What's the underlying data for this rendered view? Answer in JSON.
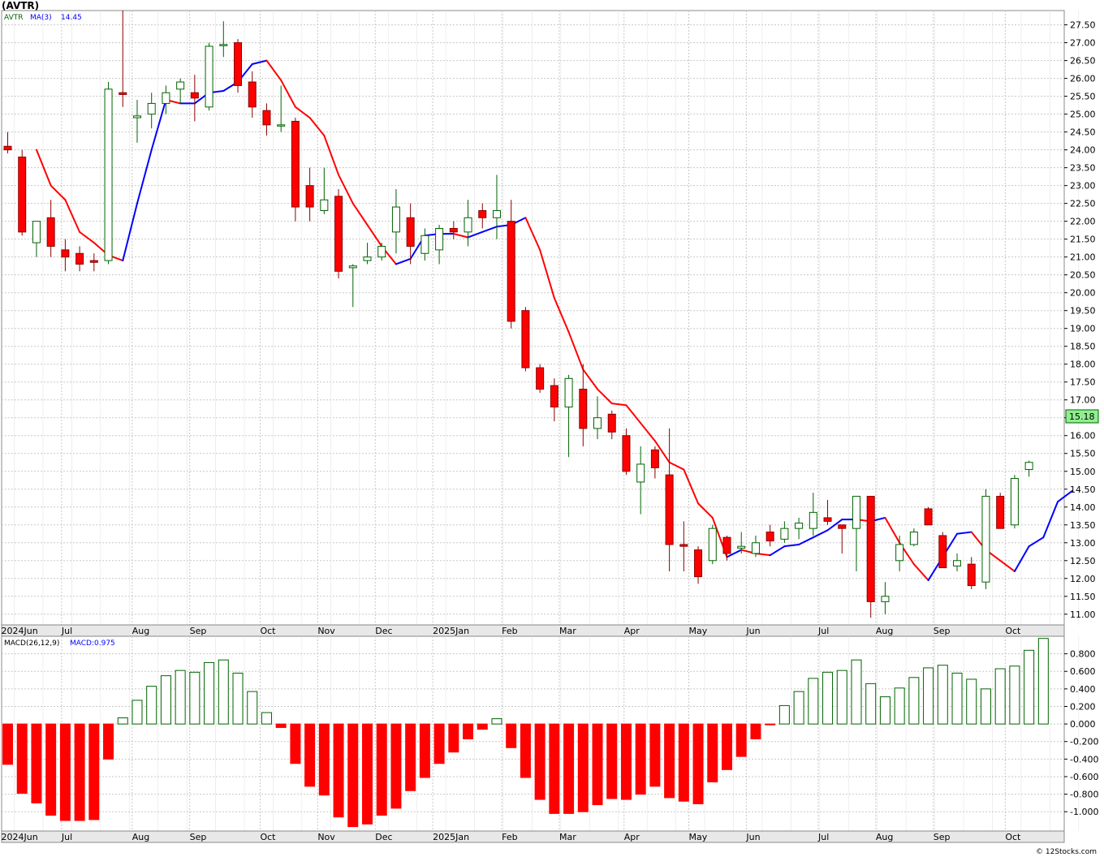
{
  "title": "(AVTR)",
  "watermark": "© 12Stocks.com",
  "colors": {
    "up_candle": "#ffffff",
    "up_outline": "#006400",
    "down_candle": "#ff0000",
    "ma_rising": "#0000ff",
    "ma_falling": "#ff0000",
    "last_price_box": "#90ee90",
    "grid": "#c8c8c8",
    "axis_band": "#e8e8e8"
  },
  "chart_data": [
    {
      "type": "candlestick",
      "symbol": "AVTR",
      "legend": {
        "symbol_label": "AVTR",
        "ma_label": "MA(3)",
        "ma_value": "14.45"
      },
      "last_price_label": "15.18",
      "ylim": [
        10.7,
        27.9
      ],
      "y_ticks": [
        "11.00",
        "11.50",
        "12.00",
        "12.50",
        "13.00",
        "13.50",
        "14.00",
        "14.50",
        "15.00",
        "15.50",
        "16.00",
        "16.50",
        "17.00",
        "17.50",
        "18.00",
        "18.50",
        "19.00",
        "19.50",
        "20.00",
        "20.50",
        "21.00",
        "21.50",
        "22.00",
        "22.50",
        "23.00",
        "23.50",
        "24.00",
        "24.50",
        "25.00",
        "25.50",
        "26.00",
        "26.50",
        "27.00",
        "27.50"
      ],
      "x_labels": [
        "2024Jun",
        "Jul",
        "Aug",
        "Sep",
        "Oct",
        "Nov",
        "Dec",
        "2025Jan",
        "Feb",
        "Mar",
        "Apr",
        "May",
        "Jun",
        "Jul",
        "Aug",
        "Sep",
        "Oct"
      ],
      "x_label_bars": [
        0,
        4.2,
        9.1,
        13.1,
        18.0,
        22.0,
        26.0,
        30.0,
        34.8,
        38.8,
        43.3,
        47.8,
        51.8,
        56.8,
        60.8,
        64.8,
        69.8
      ],
      "num_bars": 75,
      "candles": [
        {
          "o": 24.1,
          "h": 24.5,
          "l": 23.9,
          "c": 24.0
        },
        {
          "o": 23.8,
          "h": 24.0,
          "l": 21.6,
          "c": 21.7
        },
        {
          "o": 21.4,
          "h": 22.0,
          "l": 21.0,
          "c": 22.0
        },
        {
          "o": 22.1,
          "h": 22.6,
          "l": 21.0,
          "c": 21.3
        },
        {
          "o": 21.2,
          "h": 21.5,
          "l": 20.6,
          "c": 21.0
        },
        {
          "o": 21.1,
          "h": 21.3,
          "l": 20.6,
          "c": 20.8
        },
        {
          "o": 20.9,
          "h": 21.1,
          "l": 20.6,
          "c": 20.85
        },
        {
          "o": 20.9,
          "h": 25.9,
          "l": 20.8,
          "c": 25.7
        },
        {
          "o": 25.6,
          "h": 27.9,
          "l": 25.2,
          "c": 25.55
        },
        {
          "o": 24.9,
          "h": 25.4,
          "l": 24.2,
          "c": 24.95
        },
        {
          "o": 25.0,
          "h": 25.6,
          "l": 24.6,
          "c": 25.3
        },
        {
          "o": 25.3,
          "h": 25.8,
          "l": 25.0,
          "c": 25.6
        },
        {
          "o": 25.7,
          "h": 26.0,
          "l": 25.3,
          "c": 25.9
        },
        {
          "o": 25.6,
          "h": 26.1,
          "l": 24.8,
          "c": 25.45
        },
        {
          "o": 25.2,
          "h": 27.0,
          "l": 25.1,
          "c": 26.9
        },
        {
          "o": 26.95,
          "h": 27.6,
          "l": 26.6,
          "c": 26.95
        },
        {
          "o": 27.0,
          "h": 27.1,
          "l": 25.6,
          "c": 25.8
        },
        {
          "o": 25.9,
          "h": 26.2,
          "l": 24.9,
          "c": 25.2
        },
        {
          "o": 25.1,
          "h": 25.3,
          "l": 24.4,
          "c": 24.7
        },
        {
          "o": 24.7,
          "h": 25.8,
          "l": 24.5,
          "c": 24.7
        },
        {
          "o": 24.8,
          "h": 24.9,
          "l": 22.0,
          "c": 22.4
        },
        {
          "o": 23.0,
          "h": 23.5,
          "l": 22.0,
          "c": 22.4
        },
        {
          "o": 22.3,
          "h": 23.5,
          "l": 22.2,
          "c": 22.6
        },
        {
          "o": 22.7,
          "h": 22.9,
          "l": 20.4,
          "c": 20.6
        },
        {
          "o": 20.7,
          "h": 20.8,
          "l": 19.6,
          "c": 20.75
        },
        {
          "o": 20.9,
          "h": 21.4,
          "l": 20.8,
          "c": 21.0
        },
        {
          "o": 21.0,
          "h": 21.4,
          "l": 20.9,
          "c": 21.3
        },
        {
          "o": 21.7,
          "h": 22.9,
          "l": 21.1,
          "c": 22.4
        },
        {
          "o": 22.1,
          "h": 22.5,
          "l": 20.8,
          "c": 21.3
        },
        {
          "o": 21.1,
          "h": 21.8,
          "l": 20.9,
          "c": 21.6
        },
        {
          "o": 21.2,
          "h": 21.9,
          "l": 20.8,
          "c": 21.8
        },
        {
          "o": 21.8,
          "h": 22.0,
          "l": 21.5,
          "c": 21.7
        },
        {
          "o": 21.7,
          "h": 22.6,
          "l": 21.3,
          "c": 22.1
        },
        {
          "o": 22.3,
          "h": 22.5,
          "l": 21.8,
          "c": 22.1
        },
        {
          "o": 22.1,
          "h": 23.3,
          "l": 21.5,
          "c": 22.3
        },
        {
          "o": 22.0,
          "h": 22.6,
          "l": 19.0,
          "c": 19.2
        },
        {
          "o": 19.5,
          "h": 19.6,
          "l": 17.8,
          "c": 17.9
        },
        {
          "o": 17.9,
          "h": 18.0,
          "l": 17.2,
          "c": 17.3
        },
        {
          "o": 17.4,
          "h": 17.6,
          "l": 16.4,
          "c": 16.8
        },
        {
          "o": 16.8,
          "h": 17.7,
          "l": 15.4,
          "c": 17.6
        },
        {
          "o": 17.3,
          "h": 18.0,
          "l": 15.7,
          "c": 16.2
        },
        {
          "o": 16.2,
          "h": 17.1,
          "l": 15.9,
          "c": 16.5
        },
        {
          "o": 16.6,
          "h": 16.7,
          "l": 15.9,
          "c": 16.1
        },
        {
          "o": 16.0,
          "h": 16.2,
          "l": 14.9,
          "c": 15.0
        },
        {
          "o": 14.7,
          "h": 15.7,
          "l": 13.8,
          "c": 15.2
        },
        {
          "o": 15.6,
          "h": 15.7,
          "l": 14.8,
          "c": 15.1
        },
        {
          "o": 14.9,
          "h": 16.2,
          "l": 12.2,
          "c": 12.95
        },
        {
          "o": 12.95,
          "h": 13.6,
          "l": 12.2,
          "c": 12.9
        },
        {
          "o": 12.8,
          "h": 12.9,
          "l": 11.85,
          "c": 12.05
        },
        {
          "o": 12.5,
          "h": 13.5,
          "l": 12.4,
          "c": 13.4
        },
        {
          "o": 13.15,
          "h": 13.2,
          "l": 12.5,
          "c": 12.7
        },
        {
          "o": 12.85,
          "h": 13.3,
          "l": 12.7,
          "c": 12.9
        },
        {
          "o": 12.7,
          "h": 13.2,
          "l": 12.6,
          "c": 13.0
        },
        {
          "o": 13.3,
          "h": 13.5,
          "l": 12.9,
          "c": 13.05
        },
        {
          "o": 13.1,
          "h": 13.6,
          "l": 13.0,
          "c": 13.4
        },
        {
          "o": 13.4,
          "h": 13.7,
          "l": 13.1,
          "c": 13.55
        },
        {
          "o": 13.4,
          "h": 14.4,
          "l": 13.2,
          "c": 13.85
        },
        {
          "o": 13.7,
          "h": 14.2,
          "l": 13.5,
          "c": 13.6
        },
        {
          "o": 13.5,
          "h": 13.5,
          "l": 12.7,
          "c": 13.4
        },
        {
          "o": 13.4,
          "h": 14.3,
          "l": 12.2,
          "c": 14.3
        },
        {
          "o": 14.3,
          "h": 14.3,
          "l": 10.9,
          "c": 11.35
        },
        {
          "o": 11.35,
          "h": 11.9,
          "l": 11.0,
          "c": 11.5
        },
        {
          "o": 12.5,
          "h": 13.2,
          "l": 12.2,
          "c": 12.95
        },
        {
          "o": 12.95,
          "h": 13.4,
          "l": 12.9,
          "c": 13.3
        },
        {
          "o": 13.95,
          "h": 14.0,
          "l": 13.5,
          "c": 13.5
        },
        {
          "o": 13.2,
          "h": 13.3,
          "l": 12.3,
          "c": 12.3
        },
        {
          "o": 12.35,
          "h": 12.7,
          "l": 12.2,
          "c": 12.5
        },
        {
          "o": 12.4,
          "h": 12.6,
          "l": 11.7,
          "c": 11.8
        },
        {
          "o": 11.9,
          "h": 14.5,
          "l": 11.7,
          "c": 14.3
        },
        {
          "o": 14.3,
          "h": 14.4,
          "l": 13.4,
          "c": 13.4
        },
        {
          "o": 13.5,
          "h": 14.9,
          "l": 13.4,
          "c": 14.8
        },
        {
          "o": 15.05,
          "h": 15.3,
          "l": 14.85,
          "c": 15.25
        }
      ],
      "ma3": [
        24.0,
        23.0,
        22.6,
        21.7,
        21.4,
        21.05,
        20.9,
        22.5,
        24.0,
        25.4,
        25.3,
        25.3,
        25.6,
        25.65,
        25.9,
        26.4,
        26.5,
        25.95,
        25.2,
        24.9,
        24.4,
        23.3,
        22.5,
        21.9,
        21.3,
        20.8,
        20.95,
        21.6,
        21.65,
        21.65,
        21.55,
        21.7,
        21.85,
        21.9,
        22.1,
        21.2,
        19.85,
        18.9,
        17.85,
        17.3,
        16.9,
        16.85,
        16.35,
        15.85,
        15.25,
        15.05,
        14.1,
        13.7,
        12.6,
        12.8,
        12.7,
        12.65,
        12.9,
        12.95,
        13.15,
        13.35,
        13.65,
        13.65,
        13.6,
        13.7,
        13.0,
        12.4,
        11.95,
        12.6,
        13.25,
        13.3,
        12.8,
        12.5,
        12.2,
        12.9,
        13.15,
        14.15,
        14.45
      ],
      "ma_offset": 2
    },
    {
      "type": "bar",
      "legend": {
        "label": "MACD(26,12,9)",
        "value_label": "MACD:0.975"
      },
      "ylim": [
        -1.22,
        1.0
      ],
      "y_ticks": [
        "0.800",
        "0.600",
        "0.400",
        "0.200",
        "0.000",
        "-0.200",
        "-0.400",
        "-0.600",
        "-0.800",
        "-1.000"
      ],
      "x_labels": [
        "2024Jun",
        "Jul",
        "Aug",
        "Sep",
        "Oct",
        "Nov",
        "Dec",
        "2025Jan",
        "Feb",
        "Mar",
        "Apr",
        "May",
        "Jun",
        "Jul",
        "Aug",
        "Sep",
        "Oct"
      ],
      "values": [
        -0.46,
        -0.79,
        -0.9,
        -1.04,
        -1.1,
        -1.1,
        -1.09,
        -0.4,
        0.07,
        0.27,
        0.43,
        0.55,
        0.61,
        0.59,
        0.7,
        0.73,
        0.58,
        0.37,
        0.13,
        -0.04,
        -0.45,
        -0.71,
        -0.81,
        -1.06,
        -1.17,
        -1.14,
        -1.04,
        -0.96,
        -0.76,
        -0.61,
        -0.45,
        -0.32,
        -0.17,
        -0.06,
        0.06,
        -0.27,
        -0.61,
        -0.86,
        -1.02,
        -1.02,
        -1.0,
        -0.92,
        -0.85,
        -0.86,
        -0.8,
        -0.71,
        -0.84,
        -0.88,
        -0.91,
        -0.66,
        -0.52,
        -0.37,
        -0.17,
        -0.01,
        0.21,
        0.37,
        0.52,
        0.59,
        0.61,
        0.73,
        0.46,
        0.31,
        0.41,
        0.53,
        0.64,
        0.67,
        0.58,
        0.51,
        0.4,
        0.63,
        0.66,
        0.84,
        0.975
      ]
    }
  ]
}
